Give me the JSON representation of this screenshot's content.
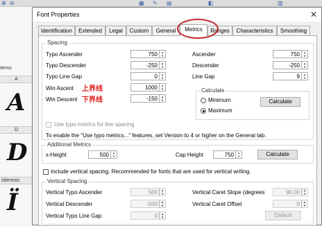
{
  "background": {
    "items_label": "items",
    "col_a": "A",
    "col_d": "D",
    "col_idieresis": "Idieresis",
    "glyphs": [
      "A",
      "D",
      "Ï"
    ]
  },
  "dialog": {
    "title": "Font Properties",
    "close": "✕",
    "tabs": [
      "Identification",
      "Extended",
      "Legal",
      "Custom",
      "General",
      "Metrics",
      "Ranges",
      "Characteristics",
      "Smoothing"
    ],
    "active_tab": "Metrics",
    "highlight_color": "#c0262b",
    "spacing": {
      "title": "Spacing",
      "typo_ascender": {
        "label": "Typo Ascender",
        "value": "750"
      },
      "typo_descender": {
        "label": "Typo Descender",
        "value": "-250"
      },
      "typo_line_gap": {
        "label": "Typo Line Gap",
        "value": "0"
      },
      "win_ascent": {
        "label": "Win Ascent",
        "value": "1000",
        "note": "上界线"
      },
      "win_descent": {
        "label": "Win Descent",
        "value": "-150",
        "note": "下界线"
      },
      "ascender": {
        "label": "Ascender",
        "value": "750"
      },
      "descender": {
        "label": "Descender",
        "value": "-250"
      },
      "line_gap": {
        "label": "Line Gap",
        "value": "9"
      },
      "calculate": {
        "title": "Calculate",
        "minimum": "Minimum",
        "maximum": "Maximum",
        "selected": "Maximum",
        "button": "Calculate"
      },
      "use_typo_metrics": "Use typo metrics for line spacing",
      "hint": "To enable the \"Use typo metrics...\" features, set Version to 4 or higher on the General tab."
    },
    "additional": {
      "title": "Additional Metrics",
      "x_height": {
        "label": "x-Height",
        "value": "500"
      },
      "cap_height": {
        "label": "Cap Height",
        "value": "750"
      },
      "button": "Calculate"
    },
    "include_vertical": "Include vertical spacing. Recommended for fonts that are used for vertical writing.",
    "vertical": {
      "title": "Vertical Spacing",
      "typo_ascender": {
        "label": "Vertical Typo Ascender",
        "value": "500"
      },
      "descender": {
        "label": "Vertical Descender",
        "value": "-500"
      },
      "typo_line_gap": {
        "label": "Vertical Typo Line Gap",
        "value": "0"
      },
      "caret_slope": {
        "label": "Vertical Caret Slope (degrees",
        "value": "90.00"
      },
      "caret_offset": {
        "label": "Vertical Caret Offset",
        "value": "0"
      },
      "default_button": "Default"
    }
  }
}
